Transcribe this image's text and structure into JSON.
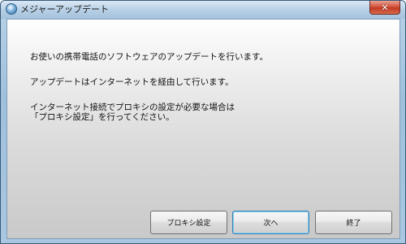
{
  "window": {
    "title": "メジャーアップデート",
    "close_label": "✕"
  },
  "content": {
    "line1": "お使いの携帯電話のソフトウェアのアップデートを行います。",
    "line2": "アップデートはインターネットを経由して行います。",
    "line3": "インターネット接続でプロキシの設定が必要な場合は",
    "line4": "「プロキシ設定」を行ってください。"
  },
  "buttons": {
    "proxy": "プロキシ設定",
    "next": "次へ",
    "exit": "終了"
  }
}
